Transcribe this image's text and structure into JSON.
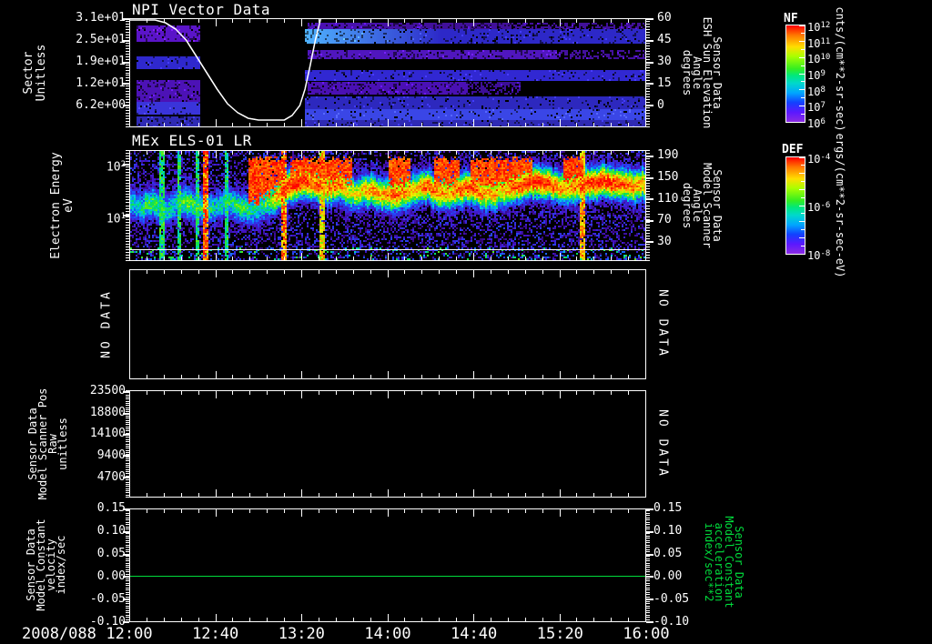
{
  "x_axis": {
    "date_label": "2008/088",
    "tick_labels": [
      "12:00",
      "12:40",
      "13:20",
      "14:00",
      "14:40",
      "15:20",
      "16:00"
    ],
    "minor_tick_minutes": 8,
    "major_tick_minutes": 40
  },
  "chart_data": [
    {
      "id": "npi",
      "type": "heatmap",
      "title": "NPI Vector Data",
      "y_axis_left": {
        "label": "Sector\nUnitless",
        "ticks": [
          "3.1e+01",
          "2.5e+01",
          "1.9e+01",
          "1.2e+01",
          "6.2e+00"
        ]
      },
      "y_axis_right": {
        "label": "Sensor Data\nESH Sun Elevation\nAngle\ndegrees",
        "ticks": [
          "60",
          "45",
          "30",
          "15",
          "0"
        ]
      },
      "colorbar": {
        "title": "NF",
        "units": "cnts/(cm**2-sr-sec)",
        "ticks": [
          "10^12",
          "10^11",
          "10^10",
          "10^9",
          "10^8",
          "10^7",
          "10^6"
        ]
      },
      "time_range": [
        "2008/088 12:00",
        "2008/088 16:00"
      ],
      "data_gap_x_frac": [
        0.135,
        0.34
      ],
      "overlay_curve": {
        "name": "sun-elevation-angle",
        "color": "#ffffff",
        "points": [
          [
            0,
            2
          ],
          [
            0.05,
            2
          ],
          [
            0.07,
            5
          ],
          [
            0.09,
            12
          ],
          [
            0.11,
            24
          ],
          [
            0.13,
            42
          ],
          [
            0.15,
            60
          ],
          [
            0.17,
            78
          ],
          [
            0.19,
            94
          ],
          [
            0.21,
            104
          ],
          [
            0.23,
            110
          ],
          [
            0.25,
            112
          ],
          [
            0.3,
            112
          ],
          [
            0.315,
            107
          ],
          [
            0.33,
            96
          ],
          [
            0.34,
            78
          ],
          [
            0.35,
            52
          ],
          [
            0.36,
            24
          ],
          [
            0.368,
            6
          ],
          [
            0.372,
            -3
          ]
        ]
      },
      "bands": [
        [
          8,
          77,
          8,
          26,
          "#5a14c8",
          "#5a14c8",
          0.5
        ],
        [
          8,
          77,
          42,
          55,
          "#2f28cd",
          "#2f28cd",
          0.18
        ],
        [
          8,
          77,
          68,
          92,
          "#4c12b6",
          "#4c12b6",
          0.5
        ],
        [
          8,
          77,
          92,
          106,
          "#3a34da",
          "#3a34da",
          0.2
        ],
        [
          8,
          77,
          108,
          119,
          "#2f2ab4",
          "#2f2ab4",
          0.3
        ],
        [
          196,
          420,
          5,
          12,
          "#4c12b6",
          "#41109a",
          0.5
        ],
        [
          420,
          568,
          5,
          12,
          "#41109a",
          "#41109a",
          0.85
        ],
        [
          193,
          568,
          12,
          27,
          "#4fb2ff",
          "#2d28c8",
          0.3
        ],
        [
          196,
          470,
          35,
          45,
          "#5016be",
          "#5016be",
          0.5
        ],
        [
          470,
          568,
          35,
          45,
          "#43109e",
          "#43109e",
          0.85
        ],
        [
          193,
          568,
          57,
          68,
          "#3128d2",
          "#3128d2",
          0.18
        ],
        [
          196,
          372,
          70,
          84,
          "#4a10b4",
          "#4a10b4",
          0.5
        ],
        [
          372,
          430,
          70,
          84,
          "#3c0e96",
          "#3c0e96",
          0.85
        ],
        [
          193,
          568,
          86,
          100,
          "#2d28be",
          "#2d28be",
          0.2
        ],
        [
          193,
          568,
          100,
          112,
          "#3a46e6",
          "#3a46e6",
          0.15
        ],
        [
          193,
          568,
          112,
          119,
          "#2f2ab4",
          "#2f2ab4",
          0.25
        ]
      ]
    },
    {
      "id": "els",
      "type": "spectrogram",
      "title": "MEx ELS-01 LR",
      "y_axis_left": {
        "label": "Electron Energy\neV",
        "ticks": [
          "10^2",
          "10^1"
        ],
        "scale": "log"
      },
      "y_axis_right": {
        "label": "Sensor Data\nModel Scanner\nAngle\ndegrees",
        "ticks": [
          "190",
          "150",
          "110",
          "70",
          "30"
        ]
      },
      "colorbar": {
        "title": "DEF",
        "units": "ergs/(cm**2-sr-sec-eV)",
        "ticks": [
          "10^-4",
          "10^-6",
          "10^-8"
        ]
      },
      "white_line_y_frac": 0.9,
      "band_center": [
        0.5,
        0.52,
        0.48,
        0.55,
        0.5,
        0.45,
        0.52,
        0.55,
        0.5,
        0.48,
        0.52,
        0.55,
        0.5,
        0.45,
        0.35,
        0.3,
        0.28,
        0.32,
        0.35,
        0.3,
        0.4,
        0.38,
        0.35,
        0.4,
        0.42,
        0.38,
        0.35,
        0.32,
        0.38,
        0.4,
        0.36,
        0.33,
        0.38,
        0.4,
        0.37,
        0.33,
        0.3,
        0.28,
        0.3,
        0.33,
        0.35,
        0.32,
        0.3,
        0.28,
        0.3,
        0.32,
        0.33,
        0.3
      ],
      "band_intensity": [
        0.45,
        0.5,
        0.55,
        0.5,
        0.45,
        0.6,
        0.55,
        0.5,
        0.45,
        0.5,
        0.55,
        0.5,
        0.5,
        0.7,
        0.95,
        1,
        0.95,
        0.9,
        0.85,
        0.9,
        0.7,
        0.75,
        0.85,
        0.8,
        0.9,
        0.85,
        0.75,
        0.9,
        0.85,
        0.8,
        0.9,
        0.95,
        0.85,
        0.8,
        0.75,
        0.9,
        0.95,
        1,
        0.95,
        0.85,
        0.8,
        0.9,
        0.95,
        1,
        0.95,
        0.9,
        0.85,
        0.8
      ],
      "red_bursts": [
        [
          0.23,
          0.3
        ],
        [
          0.31,
          0.43
        ],
        [
          0.5,
          0.545
        ],
        [
          0.59,
          0.64
        ],
        [
          0.66,
          0.7
        ],
        [
          0.7,
          0.78
        ],
        [
          0.84,
          0.88
        ]
      ],
      "vertical_streaks": [
        [
          0.146,
          0.95
        ],
        [
          0.296,
          0.9
        ],
        [
          0.372,
          0.8
        ],
        [
          0.877,
          0.85
        ]
      ],
      "green_streaks": [
        0.06,
        0.095,
        0.13,
        0.185
      ]
    },
    {
      "id": "panel3",
      "type": "empty",
      "status_left": "NO DATA",
      "status_right": "NO DATA"
    },
    {
      "id": "scanner-pos",
      "type": "empty",
      "y_axis_left": {
        "label": "Sensor Data\nModel Scanner Pos\nRaw\nunitless",
        "ticks": [
          "23500",
          "18800",
          "14100",
          "9400",
          "4700"
        ]
      },
      "status_right": "NO DATA"
    },
    {
      "id": "velocity",
      "type": "line",
      "y_axis_left": {
        "label": "Sensor Data\nModel Constant\nvelocity\nindex/sec",
        "ticks": [
          "0.15",
          "0.10",
          "0.05",
          "0.00",
          "-0.05",
          "-0.10"
        ]
      },
      "y_axis_right": {
        "label": "Sensor Data\nModel Constant\nacceleration\nindex/sec**2",
        "ticks": [
          "0.15",
          "0.10",
          "0.05",
          "0.00",
          "-0.05",
          "-0.10"
        ],
        "color": "#00dc3c"
      },
      "ylim": [
        -0.1,
        0.15
      ],
      "series": [
        {
          "name": "velocity",
          "color": "#00dc3c",
          "value": 0.0
        }
      ]
    }
  ]
}
